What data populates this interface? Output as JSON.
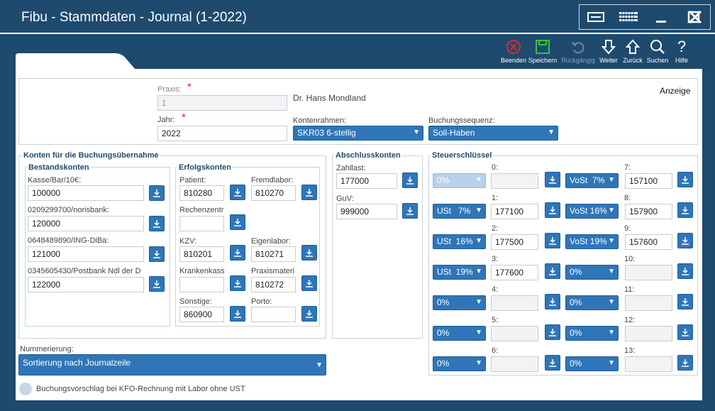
{
  "window": {
    "title": "Fibu - Stammdaten - Journal (1-2022)"
  },
  "toolbar": [
    {
      "label": "Beenden",
      "icon": "close-circle-icon",
      "enabled": true
    },
    {
      "label": "Speichern",
      "icon": "save-icon",
      "enabled": true
    },
    {
      "label": "Rückgängig",
      "icon": "undo-icon",
      "enabled": false
    },
    {
      "label": "Weiter",
      "icon": "arrow-down-icon",
      "enabled": true
    },
    {
      "label": "Zurück",
      "icon": "arrow-up-icon",
      "enabled": true
    },
    {
      "label": "Suchen",
      "icon": "search-icon",
      "enabled": true
    },
    {
      "label": "Hilfe",
      "icon": "help-icon",
      "enabled": true
    }
  ],
  "top": {
    "praxis_label": "Praxis:",
    "praxis_value": "1",
    "praxis_name": "Dr. Hans Mondland",
    "anzeige": "Anzeige",
    "jahr_label": "Jahr:",
    "jahr_value": "2022",
    "kontenrahmen_label": "Kontenrahmen:",
    "kontenrahmen_value": "SKR03 6-stellig",
    "buchungssequenz_label": "Buchungssequenz:",
    "buchungssequenz_value": "Soll-Haben"
  },
  "konten": {
    "header": "Konten für die Buchungsübernahme",
    "bestand": {
      "header": "Bestandskonten",
      "items": [
        {
          "label": "Kasse/Bar/10€:",
          "value": "100000"
        },
        {
          "label": "0209299700/norisbank:",
          "value": "120000"
        },
        {
          "label": "0648489890/ING-DiBa:",
          "value": "121000"
        },
        {
          "label": "0345605430/Postbank Ndl der D",
          "value": "122000"
        }
      ]
    },
    "erfolg": {
      "header": "Erfolgskonten",
      "items": [
        {
          "label": "Patient:",
          "value": "810280"
        },
        {
          "label": "Fremdlabor:",
          "value": "810270"
        },
        {
          "label": "Rechenzentr",
          "value": ""
        },
        {
          "label": "KZV:",
          "value": "810201"
        },
        {
          "label": "Eigenlabor:",
          "value": "810271"
        },
        {
          "label": "Krankenkass",
          "value": ""
        },
        {
          "label": "Praxismateri",
          "value": "810272"
        },
        {
          "label": "Sonstige:",
          "value": "860900"
        },
        {
          "label": "Porto:",
          "value": ""
        }
      ]
    }
  },
  "abschluss": {
    "header": "Abschlusskonten",
    "items": [
      {
        "label": "Zahllast:",
        "value": "177000"
      },
      {
        "label": "GuV:",
        "value": "999000"
      }
    ]
  },
  "steuer": {
    "header": "Steuerschlüssel",
    "left": [
      {
        "num": "0:",
        "sel": "0%",
        "value": ""
      },
      {
        "num": "1:",
        "sel": "USt   7%",
        "value": "177100"
      },
      {
        "num": "2:",
        "sel": "USt  16%",
        "value": "177500"
      },
      {
        "num": "3:",
        "sel": "USt  19%",
        "value": "177600"
      },
      {
        "num": "4:",
        "sel": "0%",
        "value": ""
      },
      {
        "num": "5:",
        "sel": "0%",
        "value": ""
      },
      {
        "num": "6:",
        "sel": "0%",
        "value": ""
      }
    ],
    "right": [
      {
        "num": "7:",
        "sel": "VoSt  7%",
        "value": "157100"
      },
      {
        "num": "8:",
        "sel": "VoSt 16%",
        "value": "157900"
      },
      {
        "num": "9:",
        "sel": "VoSt 19%",
        "value": "157600"
      },
      {
        "num": "10:",
        "sel": "0%",
        "value": ""
      },
      {
        "num": "11:",
        "sel": "0%",
        "value": ""
      },
      {
        "num": "12:",
        "sel": "0%",
        "value": ""
      },
      {
        "num": "13:",
        "sel": "0%",
        "value": ""
      }
    ]
  },
  "nummerierung": {
    "label": "Nummerierung:",
    "value": "Sortierung nach Journalzeile"
  },
  "option": {
    "label": "Buchungsvorschlag bei KFO-Rechnung mit Labor ohne UST"
  }
}
